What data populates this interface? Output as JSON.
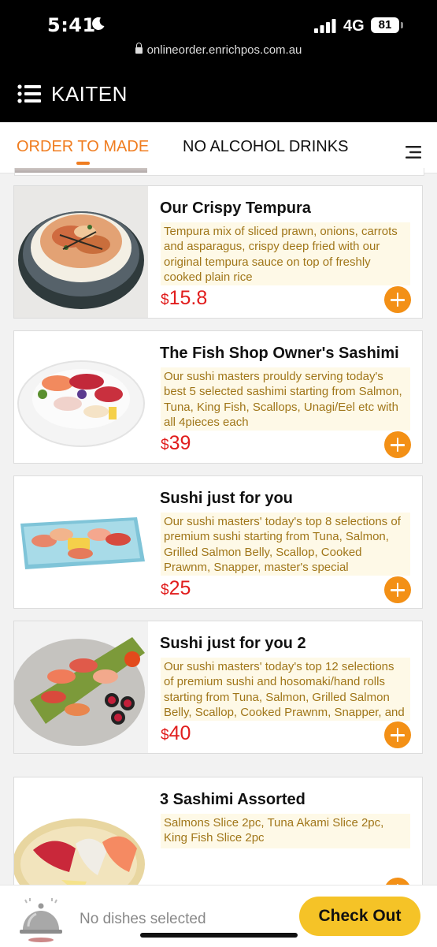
{
  "status": {
    "time": "5:41",
    "network": "4G",
    "battery": "81",
    "url": "onlineorder.enrichpos.com.au"
  },
  "header": {
    "brand": "KAITEN"
  },
  "tabs": [
    {
      "label": "ORDER TO MADE",
      "active": true
    },
    {
      "label": "NO ALCOHOL DRINKS",
      "active": false
    }
  ],
  "menu_items": [
    {
      "name": "Our Crispy Tempura",
      "description": "Tempura mix of sliced prawn, onions, carrots and asparagus, crispy deep fried with our original tempura sauce on top of freshly cooked plain rice",
      "currency": "$",
      "price": "15.8"
    },
    {
      "name": "The Fish Shop Owner's Sashimi",
      "description": "Our sushi masters prouldy serving today's best 5 selected sashimi starting from Salmon, Tuna, King Fish, Scallops, Unagi/Eel etc with all 4pieces each",
      "currency": "$",
      "price": "39"
    },
    {
      "name": "Sushi just for you",
      "description": "Our sushi masters' today's top 8 selections of premium sushi starting from Tuna, Salmon, Grilled Salmon Belly, Scallop, Cooked Prawnm, Snapper, master's special",
      "currency": "$",
      "price": "25"
    },
    {
      "name": "Sushi just for you 2",
      "description": "Our sushi masters' today's top 12 selections of premium sushi and hosomaki/hand rolls starting from Tuna, Salmon, Grilled Salmon Belly, Scallop, Cooked Prawnm, Snapper, and master's",
      "currency": "$",
      "price": "40"
    },
    {
      "name": "3 Sashimi Assorted",
      "description": "Salmons Slice 2pc, Tuna Akami Slice 2pc, King Fish Slice 2pc",
      "currency": "",
      "price": ""
    }
  ],
  "cart": {
    "empty_text": "No dishes selected",
    "checkout_label": "Check Out"
  },
  "colors": {
    "accent": "#f07d20",
    "price": "#e11d1d",
    "checkout": "#f5c327",
    "description_bg": "#fef9e7"
  }
}
